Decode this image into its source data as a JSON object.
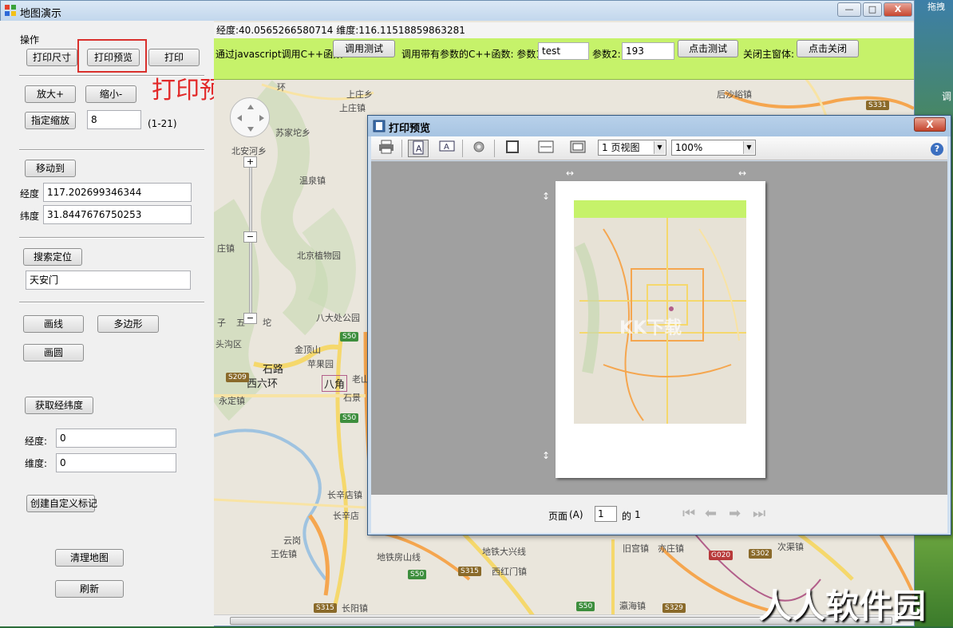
{
  "window": {
    "title": "地图演示",
    "min_label": "—",
    "max_label": "□",
    "close_label": "X"
  },
  "desktop": {
    "label1": "拖拽",
    "label2": "调"
  },
  "left_panel": {
    "section_label": "操作",
    "print_size": "打印尺寸",
    "print_preview": "打印预览",
    "print": "打印",
    "preview_caption": "打印预览",
    "zoom_in": "放大+",
    "zoom_out": "缩小-",
    "set_zoom": "指定缩放",
    "zoom_value": "8",
    "zoom_range": "(1-21)",
    "move_to": "移动到",
    "lng_label": "经度",
    "lng_value": "117.202699346344",
    "lat_label": "纬度",
    "lat_value": "31.8447676750253",
    "search_locate": "搜索定位",
    "search_value": "天安门",
    "draw_line": "画线",
    "polygon": "多边形",
    "draw_circle": "画圆",
    "get_coords": "获取经纬度",
    "lng2_label": "经度:",
    "lng2_value": "0",
    "lat2_label": "维度:",
    "lat2_value": "0",
    "custom_marker": "创建自定义标记",
    "clear_map": "清理地图",
    "refresh": "刷新"
  },
  "coord_bar": {
    "text": "经度:40.0565266580714  维度:116.11518859863281"
  },
  "green_bar": {
    "js_call_label": "通过javascript调用C++函数:",
    "call_test": "调用测试",
    "param_call_label": "调用带有参数的C++函数: 参数1:",
    "param1": "test",
    "param2_label": "参数2:",
    "param2": "193",
    "click_test": "点击测试",
    "close_main_label": "关闭主窗体:",
    "click_close": "点击关闭"
  },
  "map_labels": {
    "l1": "上庄乡",
    "l2": "上庄镇",
    "l3": "苏家坨乡",
    "l4": "北安河乡",
    "l5": "温泉镇",
    "l6": "北京植物园",
    "l7": "八大处公园",
    "l8": "金顶山",
    "l9": "苹果园",
    "l10": "八角",
    "l11": "永定镇",
    "l12": "长辛店镇",
    "l13": "长辛店",
    "l14": "云岗",
    "l15": "王佐镇",
    "l16": "地铁房山线",
    "l17": "西红门镇",
    "l18": "旧宫镇",
    "l19": "亦庄镇",
    "l20": "次渠镇",
    "l21": "后沙峪镇",
    "l22": "瀛海镇",
    "l23": "长阳镇",
    "l24": "庄镇",
    "l25": "五",
    "l26": "石景",
    "l27": "地铁大兴线",
    "l28": "老山",
    "l29": "坨",
    "l30": "子",
    "l31": "头沟区",
    "l32": "石路",
    "l33": "西六环",
    "l34": "环"
  },
  "map_shields": {
    "s1": "S50",
    "s2": "S50",
    "s3": "S209",
    "s4": "S331",
    "s5": "S50",
    "s6": "S315",
    "s7": "S50",
    "s8": "S315",
    "s9": "S329",
    "s10": "S302",
    "s11": "G020",
    "s12": "S50"
  },
  "print_preview": {
    "title": "打印预览",
    "close": "X",
    "page_view": "1 页视图",
    "zoom": "100%",
    "help": "?",
    "page_label": "页面",
    "page_accel": "(A)",
    "page_num": "1",
    "of_label": "的",
    "total_pages": "1",
    "watermark": "KK下载"
  },
  "corner_watermark": "人人软件园",
  "colors": {
    "green_bar": "#c6f26a",
    "highlight_red": "#d9302c",
    "map_bg": "#eae6dc"
  }
}
